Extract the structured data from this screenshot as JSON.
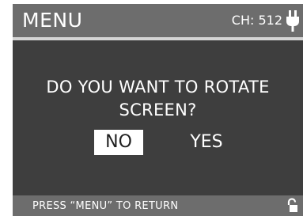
{
  "header": {
    "title": "MENU",
    "channel": "CH: 512"
  },
  "dialog": {
    "question_line1": "DO YOU WANT TO ROTATE",
    "question_line2": "SCREEN?",
    "options": [
      {
        "label": "NO",
        "selected": true
      },
      {
        "label": "YES",
        "selected": false
      }
    ]
  },
  "footer": {
    "hint": "PRESS “MENU” TO RETURN"
  },
  "icons": {
    "power": "power-plug-icon",
    "lock": "unlocked-padlock-icon"
  },
  "colors": {
    "background": "#3e3e3e",
    "bar": "#6d6d6d",
    "divider": "#d4d4d4",
    "selected_bg": "#ffffff",
    "text": "#ffffff"
  }
}
